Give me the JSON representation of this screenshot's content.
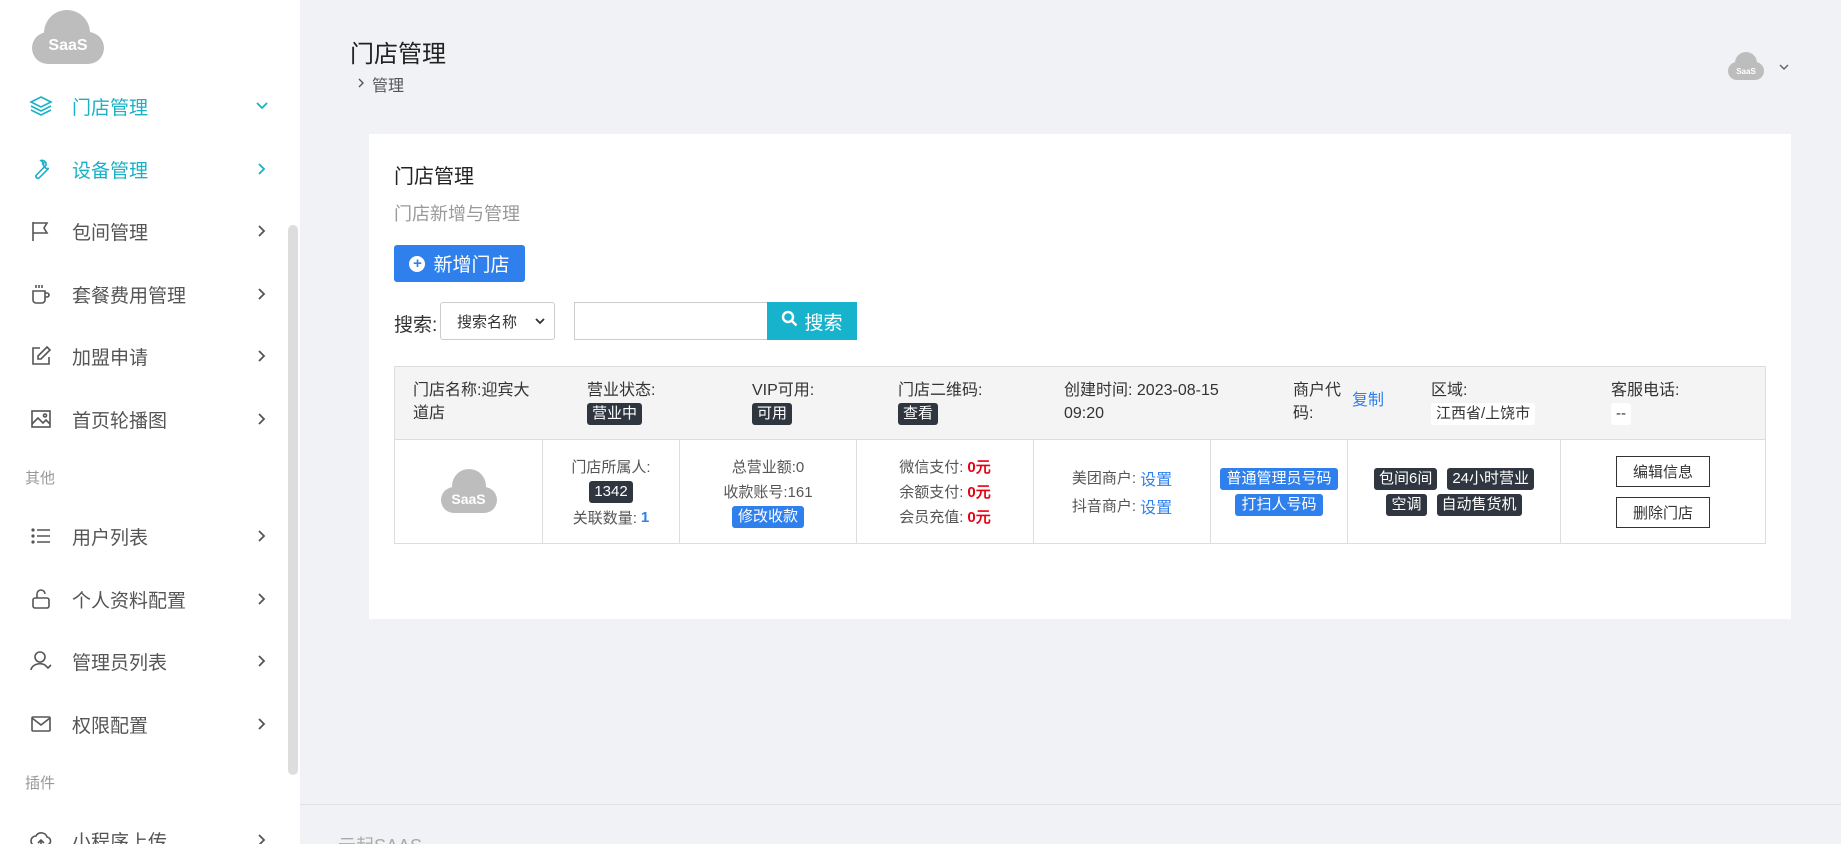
{
  "app": {
    "logo_text": "SaaS",
    "footer": "云起SAAS"
  },
  "sidebar": {
    "items": [
      {
        "label": "门店管理",
        "icon": "layers-icon",
        "active": true,
        "expanded": true
      },
      {
        "label": "设备管理",
        "icon": "wrench-icon",
        "active": true,
        "expanded": false
      },
      {
        "label": "包间管理",
        "icon": "flag-icon"
      },
      {
        "label": "套餐费用管理",
        "icon": "coffee-icon"
      },
      {
        "label": "加盟申请",
        "icon": "edit-icon"
      },
      {
        "label": "首页轮播图",
        "icon": "image-icon"
      }
    ],
    "section_other": "其他",
    "other_items": [
      {
        "label": "用户列表",
        "icon": "list-icon"
      },
      {
        "label": "个人资料配置",
        "icon": "lock-icon"
      },
      {
        "label": "管理员列表",
        "icon": "user-icon"
      },
      {
        "label": "权限配置",
        "icon": "mail-icon"
      }
    ],
    "section_plugin": "插件",
    "plugin_items": [
      {
        "label": "小程序上传",
        "icon": "upload-icon"
      }
    ]
  },
  "header": {
    "title": "门店管理",
    "breadcrumb": "管理",
    "avatar_text": "SaaS"
  },
  "card": {
    "title": "门店管理",
    "subtitle": "门店新增与管理",
    "add_button": "新增门店",
    "search_label": "搜索:",
    "search_select_value": "搜索名称",
    "search_input_value": "",
    "search_button": "搜索"
  },
  "store": {
    "name_label": "门店名称:迎宾大道店",
    "status_label": "营业状态:",
    "status_value": "营业中",
    "vip_label": "VIP可用:",
    "vip_value": "可用",
    "qr_label": "门店二维码:",
    "qr_value": "查看",
    "created_label": "创建时间: 2023-08-15 09:20",
    "merchant_code_label": "商户代码:",
    "merchant_code_action": "复制",
    "region_label": "区域:",
    "region_value": "江西省/上饶市",
    "service_phone_label": "客服电话:",
    "service_phone_value": "--",
    "logo_text": "SaaS",
    "owner_label": "门店所属人:",
    "owner_value": "1342",
    "linked_label": "关联数量:",
    "linked_value": "1",
    "total_revenue": "总营业额:0",
    "account_no": "收款账号:161",
    "modify_payee": "修改收款",
    "wechat_pay_label": "微信支付:",
    "wechat_pay_value": "0元",
    "balance_pay_label": "余额支付:",
    "balance_pay_value": "0元",
    "member_recharge_label": "会员充值:",
    "member_recharge_value": "0元",
    "meituan_label": "美团商户:",
    "meituan_action": "设置",
    "douyin_label": "抖音商户:",
    "douyin_action": "设置",
    "admin_qr": "普通管理员号码",
    "cleaner_qr": "打扫人号码",
    "tags": [
      "包间6间",
      "24小时营业",
      "空调",
      "自动售货机"
    ],
    "edit_button": "编辑信息",
    "delete_button": "删除门店"
  }
}
